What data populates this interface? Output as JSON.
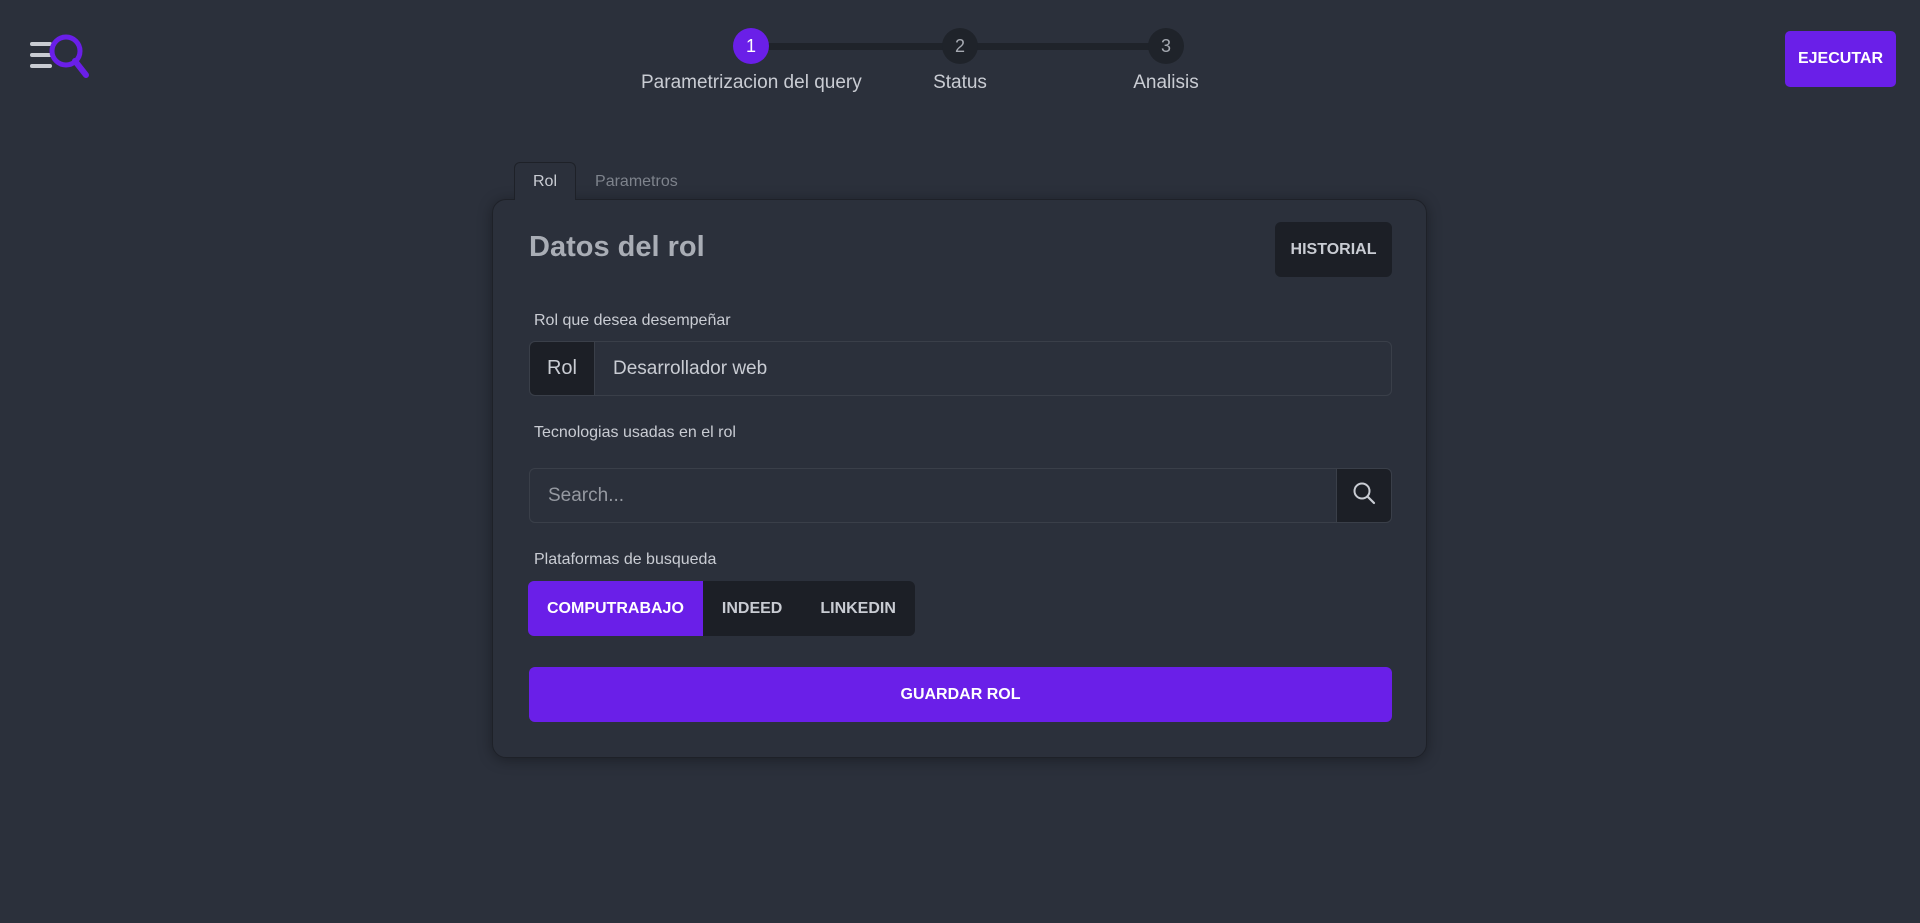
{
  "header": {
    "execute_label": "EJECUTAR"
  },
  "stepper": {
    "steps": [
      {
        "number": "1",
        "label": "Parametrizacion del query",
        "active": true
      },
      {
        "number": "2",
        "label": "Status",
        "active": false
      },
      {
        "number": "3",
        "label": "Analisis",
        "active": false
      }
    ]
  },
  "tabs": [
    {
      "label": "Rol",
      "active": true
    },
    {
      "label": "Parametros",
      "active": false
    }
  ],
  "card": {
    "title": "Datos del rol",
    "history_label": "HISTORIAL",
    "role": {
      "label": "Rol que desea desempeñar",
      "addon": "Rol",
      "value": "Desarrollador web"
    },
    "technologies": {
      "label": "Tecnologias usadas en el rol",
      "placeholder": "Search..."
    },
    "platforms": {
      "label": "Plataformas de busqueda",
      "options": [
        {
          "label": "COMPUTRABAJO",
          "active": true
        },
        {
          "label": "INDEED",
          "active": false
        },
        {
          "label": "LINKEDIN",
          "active": false
        }
      ]
    },
    "save_label": "GUARDAR ROL"
  },
  "colors": {
    "accent": "#6a1fe8",
    "background": "#2b303b",
    "surface_dark": "#1c1f26"
  },
  "icons": {
    "logo": "menu-search-logo-icon",
    "search": "search-icon"
  }
}
